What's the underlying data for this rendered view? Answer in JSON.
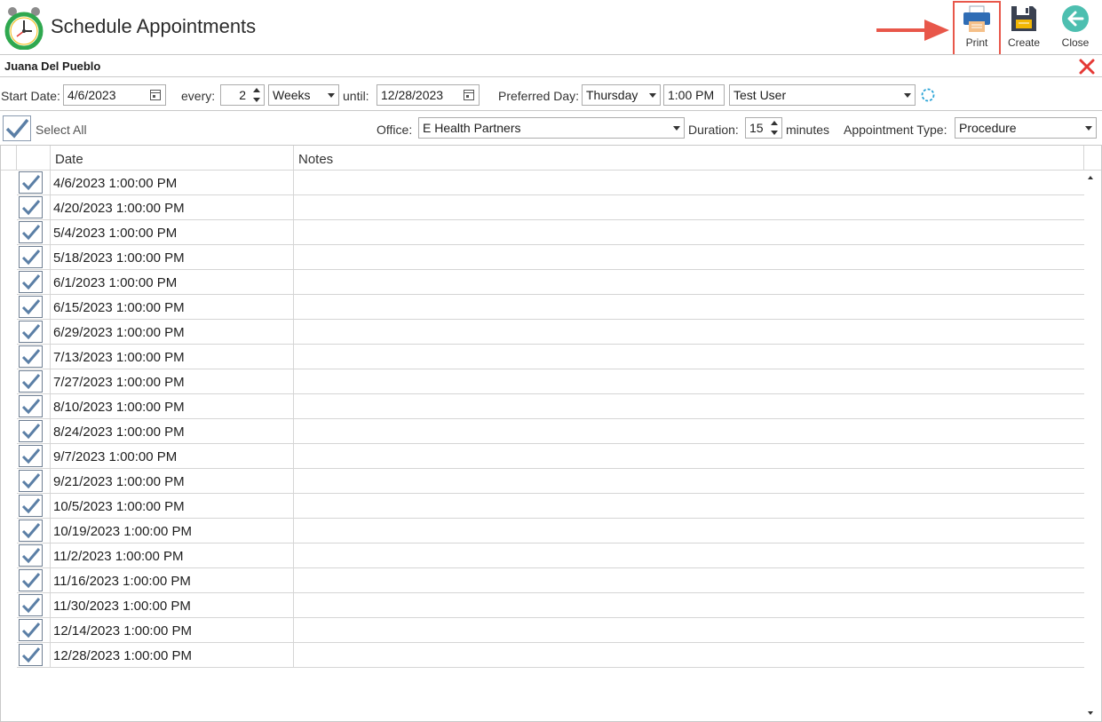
{
  "header": {
    "title": "Schedule Appointments",
    "toolbar": {
      "print_label": "Print",
      "create_label": "Create",
      "close_label": "Close"
    }
  },
  "patient": {
    "name": "Juana Del Pueblo"
  },
  "schedule": {
    "start_date_label": "Start Date:",
    "start_date": "4/6/2023",
    "every_label": "every:",
    "every_value": "2",
    "interval_unit": "Weeks",
    "until_label": "until:",
    "until_date": "12/28/2023",
    "preferred_day_label": "Preferred Day:",
    "preferred_day": "Thursday",
    "time": "1:00 PM",
    "user": "Test User"
  },
  "options": {
    "select_all_label": "Select All",
    "select_all_checked": true,
    "office_label": "Office:",
    "office": "E Health Partners",
    "duration_label": "Duration:",
    "duration": "15",
    "duration_unit": "minutes",
    "appointment_type_label": "Appointment Type:",
    "appointment_type": "Procedure"
  },
  "grid": {
    "columns": {
      "date": "Date",
      "notes": "Notes"
    },
    "rows": [
      {
        "checked": true,
        "date": "4/6/2023 1:00:00 PM",
        "notes": ""
      },
      {
        "checked": true,
        "date": "4/20/2023 1:00:00 PM",
        "notes": ""
      },
      {
        "checked": true,
        "date": "5/4/2023 1:00:00 PM",
        "notes": ""
      },
      {
        "checked": true,
        "date": "5/18/2023 1:00:00 PM",
        "notes": ""
      },
      {
        "checked": true,
        "date": "6/1/2023 1:00:00 PM",
        "notes": ""
      },
      {
        "checked": true,
        "date": "6/15/2023 1:00:00 PM",
        "notes": ""
      },
      {
        "checked": true,
        "date": "6/29/2023 1:00:00 PM",
        "notes": ""
      },
      {
        "checked": true,
        "date": "7/13/2023 1:00:00 PM",
        "notes": ""
      },
      {
        "checked": true,
        "date": "7/27/2023 1:00:00 PM",
        "notes": ""
      },
      {
        "checked": true,
        "date": "8/10/2023 1:00:00 PM",
        "notes": ""
      },
      {
        "checked": true,
        "date": "8/24/2023 1:00:00 PM",
        "notes": ""
      },
      {
        "checked": true,
        "date": "9/7/2023 1:00:00 PM",
        "notes": ""
      },
      {
        "checked": true,
        "date": "9/21/2023 1:00:00 PM",
        "notes": ""
      },
      {
        "checked": true,
        "date": "10/5/2023 1:00:00 PM",
        "notes": ""
      },
      {
        "checked": true,
        "date": "10/19/2023 1:00:00 PM",
        "notes": ""
      },
      {
        "checked": true,
        "date": "11/2/2023 1:00:00 PM",
        "notes": ""
      },
      {
        "checked": true,
        "date": "11/16/2023 1:00:00 PM",
        "notes": ""
      },
      {
        "checked": true,
        "date": "11/30/2023 1:00:00 PM",
        "notes": ""
      },
      {
        "checked": true,
        "date": "12/14/2023 1:00:00 PM",
        "notes": ""
      },
      {
        "checked": true,
        "date": "12/28/2023 1:00:00 PM",
        "notes": ""
      }
    ]
  },
  "icons": {
    "app": "alarm-clock-icon",
    "print": "printer-icon",
    "create": "floppy-disk-icon",
    "close": "back-arrow-icon",
    "clear": "red-x-icon",
    "refresh": "refresh-icon",
    "checkmark": "checkmark-icon"
  },
  "colors": {
    "accent_highlight": "#e8574a",
    "check": "#5b7fa6",
    "close_button": "#4dbfb0",
    "clear_x": "#e53935",
    "refresh": "#29a3d6"
  }
}
